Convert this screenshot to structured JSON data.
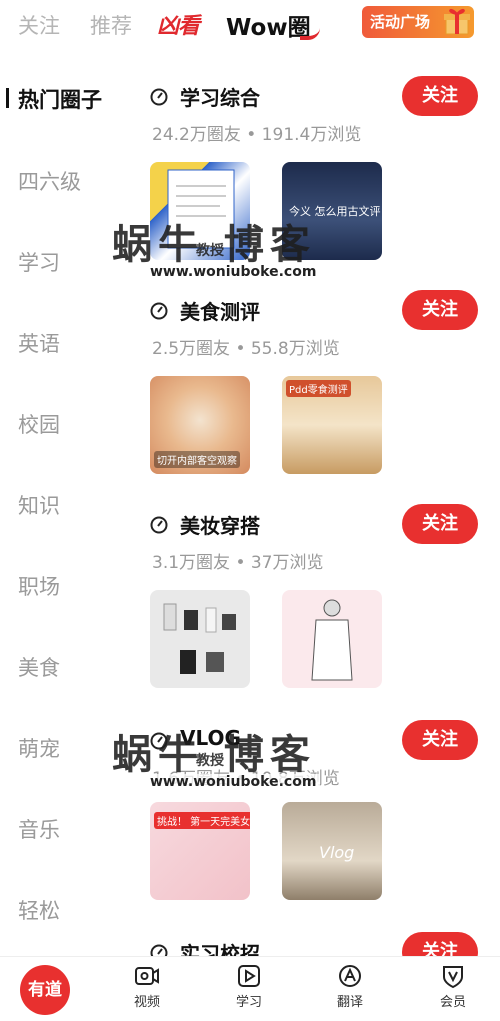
{
  "topbar": {
    "tabs": [
      {
        "label": "关注"
      },
      {
        "label": "推荐"
      }
    ],
    "logo_text": "凶看",
    "wow_label": "Wow圈",
    "activity_label": "活动广场"
  },
  "sidebar": {
    "items": [
      {
        "label": "热门圈子"
      },
      {
        "label": "四六级"
      },
      {
        "label": "学习"
      },
      {
        "label": "英语"
      },
      {
        "label": "校园"
      },
      {
        "label": "知识"
      },
      {
        "label": "职场"
      },
      {
        "label": "美食"
      },
      {
        "label": "萌宠"
      },
      {
        "label": "音乐"
      },
      {
        "label": "轻松"
      }
    ]
  },
  "circles": [
    {
      "title": "学习综合",
      "stats": "24.2万圈友 • 191.4万浏览",
      "follow": "关注",
      "thumb_a": "",
      "thumb_b": "今义 怎么用古文评"
    },
    {
      "title": "美食测评",
      "stats": "2.5万圈友 • 55.8万浏览",
      "follow": "关注",
      "thumb_a": "切开内部客空观察",
      "thumb_b": "Pdd零食测评"
    },
    {
      "title": "美妆穿搭",
      "stats": "3.1万圈友 • 37万浏览",
      "follow": "关注",
      "thumb_a": "",
      "thumb_b": ""
    },
    {
      "title": "VLOG",
      "stats": "1.6万圈友 • 10.8万浏览",
      "follow": "关注",
      "thumb_a": "挑战！ 第一天完美女孩",
      "thumb_b": "Vlog"
    },
    {
      "title": "实习校招",
      "stats": "",
      "follow": "关注"
    }
  ],
  "watermark": {
    "main": "蜗牛 博客",
    "sub": "教授",
    "url": "www.woniuboke.com"
  },
  "bottomnav": {
    "home": "有道",
    "items": [
      {
        "label": "视频"
      },
      {
        "label": "学习"
      },
      {
        "label": "翻译"
      },
      {
        "label": "会员"
      }
    ]
  },
  "colors": {
    "accent": "#e8302f"
  }
}
